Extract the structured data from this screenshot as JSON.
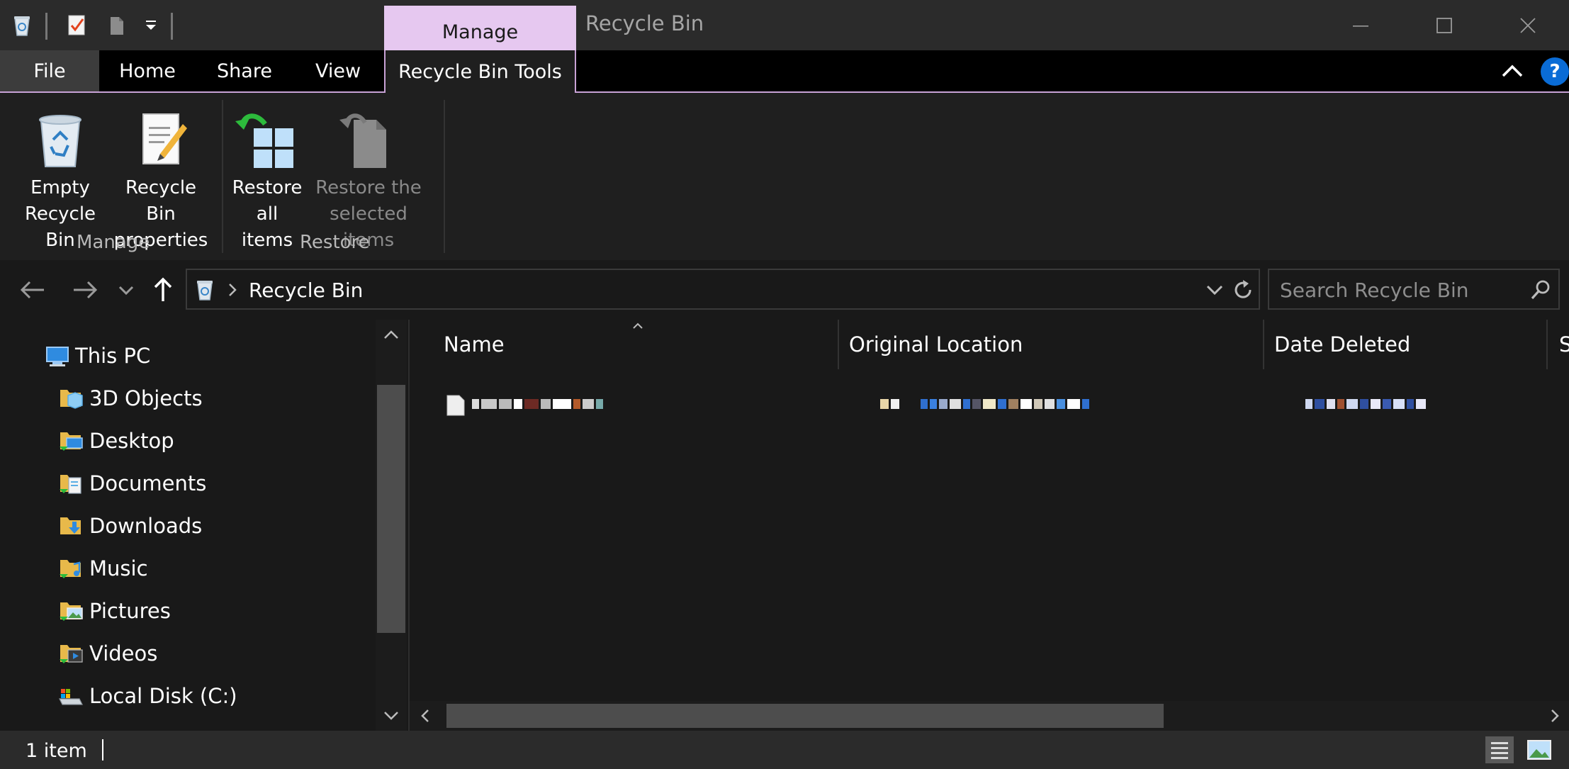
{
  "window": {
    "title": "Recycle Bin",
    "context_tab_group": "Manage",
    "accent_color": "#e6c8f0",
    "controls": [
      "minimize-icon",
      "maximize-icon",
      "close-icon"
    ]
  },
  "ribbon_tabs": {
    "file": "File",
    "home": "Home",
    "share": "Share",
    "view": "View",
    "recycle_bin_tools": "Recycle Bin Tools"
  },
  "ribbon": {
    "groups": {
      "manage": "Manage",
      "restore": "Restore"
    },
    "buttons": {
      "empty_line1": "Empty",
      "empty_line2": "Recycle Bin",
      "props_line1": "Recycle Bin",
      "props_line2": "properties",
      "restore_all_line1": "Restore",
      "restore_all_line2": "all items",
      "restore_sel_line1": "Restore the",
      "restore_sel_line2": "selected items"
    },
    "help_label": "?"
  },
  "address": {
    "path": "Recycle Bin",
    "search_placeholder": "Search Recycle Bin"
  },
  "nav_pane": {
    "items": [
      {
        "label": "This PC"
      },
      {
        "label": "3D Objects"
      },
      {
        "label": "Desktop"
      },
      {
        "label": "Documents"
      },
      {
        "label": "Downloads"
      },
      {
        "label": "Music"
      },
      {
        "label": "Pictures"
      },
      {
        "label": "Videos"
      },
      {
        "label": "Local Disk (C:)"
      }
    ]
  },
  "columns": {
    "name": "Name",
    "original_location": "Original Location",
    "date_deleted": "Date Deleted",
    "size_partial": "S"
  },
  "status": {
    "item_count": "1 item"
  }
}
